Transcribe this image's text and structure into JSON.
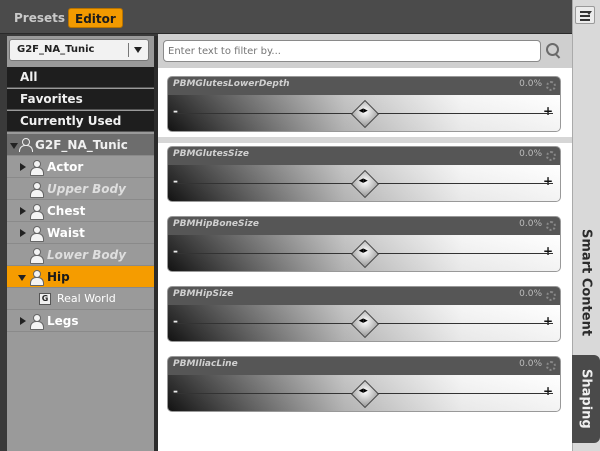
{
  "tabs": {
    "presets": "Presets",
    "editor": "Editor"
  },
  "figure_selector": {
    "value": "G2F_NA_Tunic"
  },
  "categories": [
    "All",
    "Favorites",
    "Currently Used"
  ],
  "tree": {
    "root": "G2F_NA_Tunic",
    "items": [
      {
        "label": "Actor",
        "italic": false,
        "expandable": true
      },
      {
        "label": "Upper Body",
        "italic": true,
        "expandable": false
      },
      {
        "label": "Chest",
        "italic": false,
        "expandable": true
      },
      {
        "label": "Waist",
        "italic": false,
        "expandable": true
      },
      {
        "label": "Lower Body",
        "italic": true,
        "expandable": false
      },
      {
        "label": "Hip",
        "italic": false,
        "expandable": true,
        "selected": true
      },
      {
        "label": "Real World",
        "italic": false,
        "expandable": false
      },
      {
        "label": "Legs",
        "italic": false,
        "expandable": true
      }
    ]
  },
  "filter": {
    "placeholder": "Enter text to filter by..."
  },
  "sliders": [
    {
      "name": "PBMGlutesLowerDepth",
      "value": "0.0%",
      "position": 0.5
    },
    {
      "name": "PBMGlutesSize",
      "value": "0.0%",
      "position": 0.5
    },
    {
      "name": "PBMHipBoneSize",
      "value": "0.0%",
      "position": 0.5
    },
    {
      "name": "PBMHipSize",
      "value": "0.0%",
      "position": 0.5
    },
    {
      "name": "PBMIliacLine",
      "value": "0.0%",
      "position": 0.5
    }
  ],
  "side_tabs": {
    "smart_content": "Smart Content",
    "shaping": "Shaping"
  },
  "colors": {
    "accent": "#f29a00",
    "selected_row": "#f59c00"
  }
}
